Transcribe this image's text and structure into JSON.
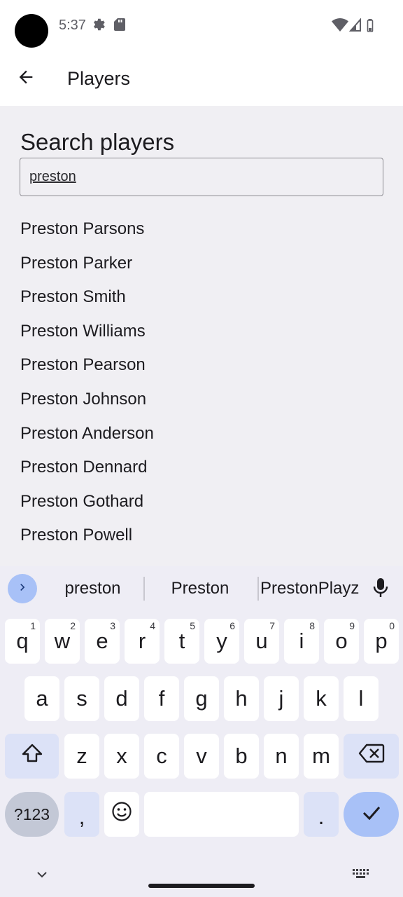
{
  "status_bar": {
    "time": "5:37"
  },
  "app_bar": {
    "title": "Players"
  },
  "search": {
    "heading": "Search players",
    "value": "preston"
  },
  "results": [
    "Preston Parsons",
    "Preston Parker",
    "Preston Smith",
    "Preston Williams",
    "Preston Pearson",
    "Preston Johnson",
    "Preston Anderson",
    "Preston Dennard",
    "Preston Gothard",
    "Preston Powell"
  ],
  "keyboard": {
    "suggestions": [
      "preston",
      "Preston",
      "PrestonPlayz"
    ],
    "row1": [
      {
        "key": "q",
        "hint": "1"
      },
      {
        "key": "w",
        "hint": "2"
      },
      {
        "key": "e",
        "hint": "3"
      },
      {
        "key": "r",
        "hint": "4"
      },
      {
        "key": "t",
        "hint": "5"
      },
      {
        "key": "y",
        "hint": "6"
      },
      {
        "key": "u",
        "hint": "7"
      },
      {
        "key": "i",
        "hint": "8"
      },
      {
        "key": "o",
        "hint": "9"
      },
      {
        "key": "p",
        "hint": "0"
      }
    ],
    "row2": [
      "a",
      "s",
      "d",
      "f",
      "g",
      "h",
      "j",
      "k",
      "l"
    ],
    "row3": [
      "z",
      "x",
      "c",
      "v",
      "b",
      "n",
      "m"
    ],
    "symbols_label": "?123",
    "comma_label": ",",
    "period_label": "."
  }
}
